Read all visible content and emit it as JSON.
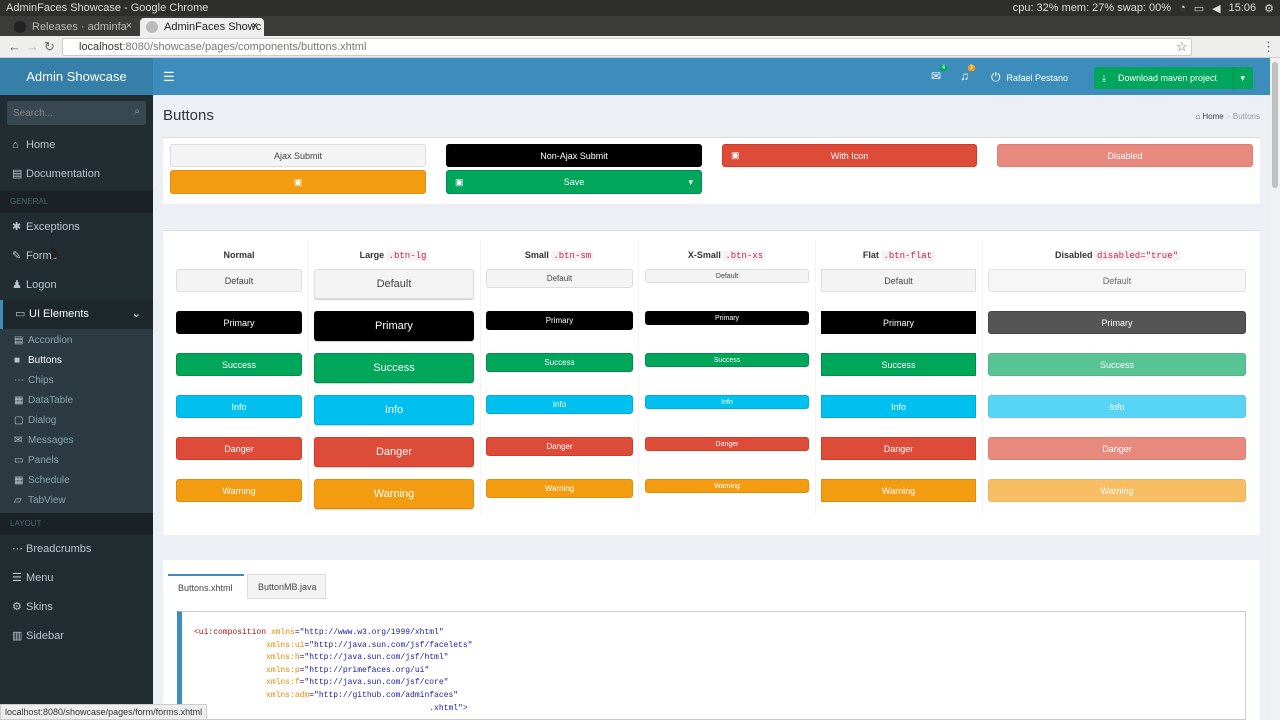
{
  "os": {
    "title": "AdminFaces Showcase - Google Chrome",
    "cpu": "cpu: 32% mem: 27% swap: 00%",
    "time": "15:06"
  },
  "browser": {
    "tabs": [
      {
        "label": "Releases · adminfa"
      },
      {
        "label": "AdminFaces Showc"
      }
    ],
    "url_host": "localhost",
    "url_path": ":8080/showcase/pages/components/buttons.xhtml",
    "status": "localhost:8080/showcase/pages/form/forms.xhtml"
  },
  "sidebar": {
    "brand": "Admin Showcase",
    "search_placeholder": "Search...",
    "items": [
      {
        "label": "Home"
      },
      {
        "label": "Documentation"
      }
    ],
    "header_general": "GENERAL",
    "general": [
      {
        "label": "Exceptions"
      },
      {
        "label": "Forms"
      },
      {
        "label": "Logon"
      },
      {
        "label": "UI Elements"
      }
    ],
    "sub": [
      {
        "label": "Accordion"
      },
      {
        "label": "Buttons"
      },
      {
        "label": "Chips"
      },
      {
        "label": "DataTable"
      },
      {
        "label": "Dialog"
      },
      {
        "label": "Messages"
      },
      {
        "label": "Panels"
      },
      {
        "label": "Schedule"
      },
      {
        "label": "TabView"
      }
    ],
    "header_layout": "LAYOUT",
    "layout": [
      {
        "label": "Breadcrumbs"
      },
      {
        "label": "Menu"
      },
      {
        "label": "Skins"
      },
      {
        "label": "Sidebar"
      }
    ]
  },
  "topbar": {
    "mail_badge": "4",
    "bell_badge": "3",
    "user": "Rafael Pestano",
    "download": "Download maven project"
  },
  "page": {
    "title": "Buttons",
    "crumb_home": "Home",
    "crumb_current": "Buttons"
  },
  "top_buttons": {
    "ajax": "Ajax Submit",
    "nonajax": "Non-Ajax Submit",
    "withicon": "With Icon",
    "disabled": "Disabled",
    "save": "Save"
  },
  "columns": [
    {
      "name": "Normal",
      "code": ""
    },
    {
      "name": "Large",
      "code": ".btn-lg"
    },
    {
      "name": "Small",
      "code": ".btn-sm"
    },
    {
      "name": "X-Small",
      "code": ".btn-xs"
    },
    {
      "name": "Flat",
      "code": ".btn-flat"
    },
    {
      "name": "Disabled",
      "code": "disabled=\"true\""
    }
  ],
  "rows": [
    "Default",
    "Primary",
    "Success",
    "Info",
    "Danger",
    "Warning"
  ],
  "codetabs": [
    {
      "label": "Buttons.xhtml"
    },
    {
      "label": "ButtonMB.java"
    }
  ],
  "code": [
    {
      "tag": "<ui:composition",
      "attr": " xmlns",
      "val": "=\"http://www.w3.org/1999/xhtml\""
    },
    {
      "tag": "               ",
      "attr": "xmlns:ui",
      "val": "=\"http://java.sun.com/jsf/facelets\""
    },
    {
      "tag": "               ",
      "attr": "xmlns:h",
      "val": "=\"http://java.sun.com/jsf/html\""
    },
    {
      "tag": "               ",
      "attr": "xmlns:p",
      "val": "=\"http://primefaces.org/ui\""
    },
    {
      "tag": "               ",
      "attr": "xmlns:f",
      "val": "=\"http://java.sun.com/jsf/core\""
    },
    {
      "tag": "               ",
      "attr": "xmlns:adm",
      "val": "=\"http://github.com/adminfaces\""
    },
    {
      "tag": "",
      "attr": "",
      "val": "                                                 .xhtml\">"
    }
  ]
}
